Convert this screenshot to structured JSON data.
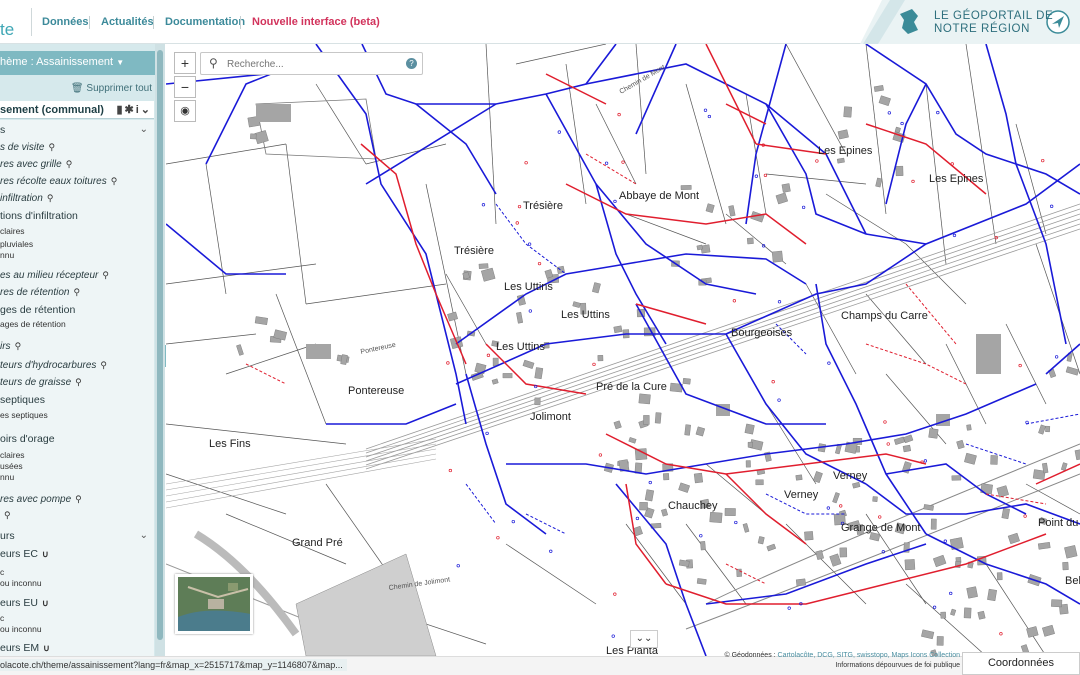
{
  "header": {
    "logo_fragment": "te",
    "nav": [
      "Données",
      "Actualités",
      "Documentation",
      "Nouvelle interface (beta)"
    ],
    "brand_text": "LE GÉOPORTAIL DE\nNOTRE RÉGION",
    "colors": {
      "nav": "#3c8a9a",
      "beta": "#d2335c",
      "brand": "#2e6f7d"
    }
  },
  "sidebar": {
    "theme_label": "hème : Assainissement",
    "clear_all": "Supprimer tout",
    "layer_title": "sement (communal)",
    "tree": [
      {
        "level": "group",
        "label": "s",
        "chevron": true
      },
      {
        "level": "item",
        "label": "s de visite",
        "zoom": true
      },
      {
        "level": "item",
        "label": "res avec grille",
        "zoom": true
      },
      {
        "level": "item",
        "label": "res récolte eaux toitures",
        "zoom": true
      },
      {
        "level": "item",
        "label": "infiltration",
        "zoom": true
      },
      {
        "level": "group",
        "label": "tions d'infiltration"
      },
      {
        "level": "sub",
        "label": "claires"
      },
      {
        "level": "sub",
        "label": "pluviales"
      },
      {
        "level": "sub",
        "label": "nnu"
      },
      {
        "level": "item",
        "label": "es au milieu récepteur",
        "zoom": true
      },
      {
        "level": "item",
        "label": "res de rétention",
        "zoom": true
      },
      {
        "level": "group",
        "label": "ges de rétention"
      },
      {
        "level": "sub",
        "label": "ages de rétention"
      },
      {
        "level": "item",
        "label": "irs",
        "zoom": true
      },
      {
        "level": "item",
        "label": "teurs d'hydrocarbures",
        "zoom": true
      },
      {
        "level": "item",
        "label": "teurs de graisse",
        "zoom": true
      },
      {
        "level": "group",
        "label": "septiques"
      },
      {
        "level": "sub",
        "label": "es septiques"
      },
      {
        "level": "group",
        "label": "oirs d'orage"
      },
      {
        "level": "sub",
        "label": "claires"
      },
      {
        "level": "sub",
        "label": "usées"
      },
      {
        "level": "sub",
        "label": "nnu"
      },
      {
        "level": "item",
        "label": "res avec pompe",
        "zoom": true
      },
      {
        "level": "item",
        "label": "",
        "zoom": true
      },
      {
        "level": "group",
        "label": "urs",
        "chevron": true
      },
      {
        "level": "group",
        "label": "eurs EC",
        "magnet": true
      },
      {
        "level": "sub",
        "label": "c"
      },
      {
        "level": "sub",
        "label": "ou inconnu"
      },
      {
        "level": "group",
        "label": "eurs EU",
        "magnet": true
      },
      {
        "level": "sub",
        "label": "c"
      },
      {
        "level": "sub",
        "label": "ou inconnu"
      },
      {
        "level": "group",
        "label": "eurs EM",
        "magnet": true
      }
    ]
  },
  "map": {
    "search_placeholder": "Recherche...",
    "zoom_in": "+",
    "zoom_out": "−",
    "locate_icon": "locate-icon",
    "place_names": [
      "Les Epines",
      "Les Epines",
      "Trésière",
      "Trésière",
      "Abbaye de Mont",
      "Les Uttins",
      "Les Uttins",
      "Les Uttins",
      "Bourgeoises",
      "Champs du Carre",
      "Pontereuse",
      "Pré de la Cure",
      "Jolimont",
      "Les Fins",
      "Verney",
      "Verney",
      "Chauchey",
      "Grange de Mont",
      "Grand Pré",
      "Point du",
      "Bel",
      "Les Planta"
    ],
    "street_labels": [
      "Chemin de Jolimont",
      "Pontereuse",
      "Chemin de Mont"
    ],
    "colors": {
      "sewer_blue": "#1a1ad8",
      "sewer_red": "#e01e2e",
      "parcel": "#555555",
      "building": "#a5a5a5"
    }
  },
  "footer": {
    "url": "olacote.ch/theme/assainissement?lang=fr&map_x=2515717&map_y=1146807&map...",
    "credits_prefix": "© Géodonnées : ",
    "credits_links": "Cartolacôte, DCG, SITG, swisstopo, Maps Icons Collection",
    "credits_note": "Informations dépourvues de foi publique",
    "coords_button": "Coordonnées"
  }
}
